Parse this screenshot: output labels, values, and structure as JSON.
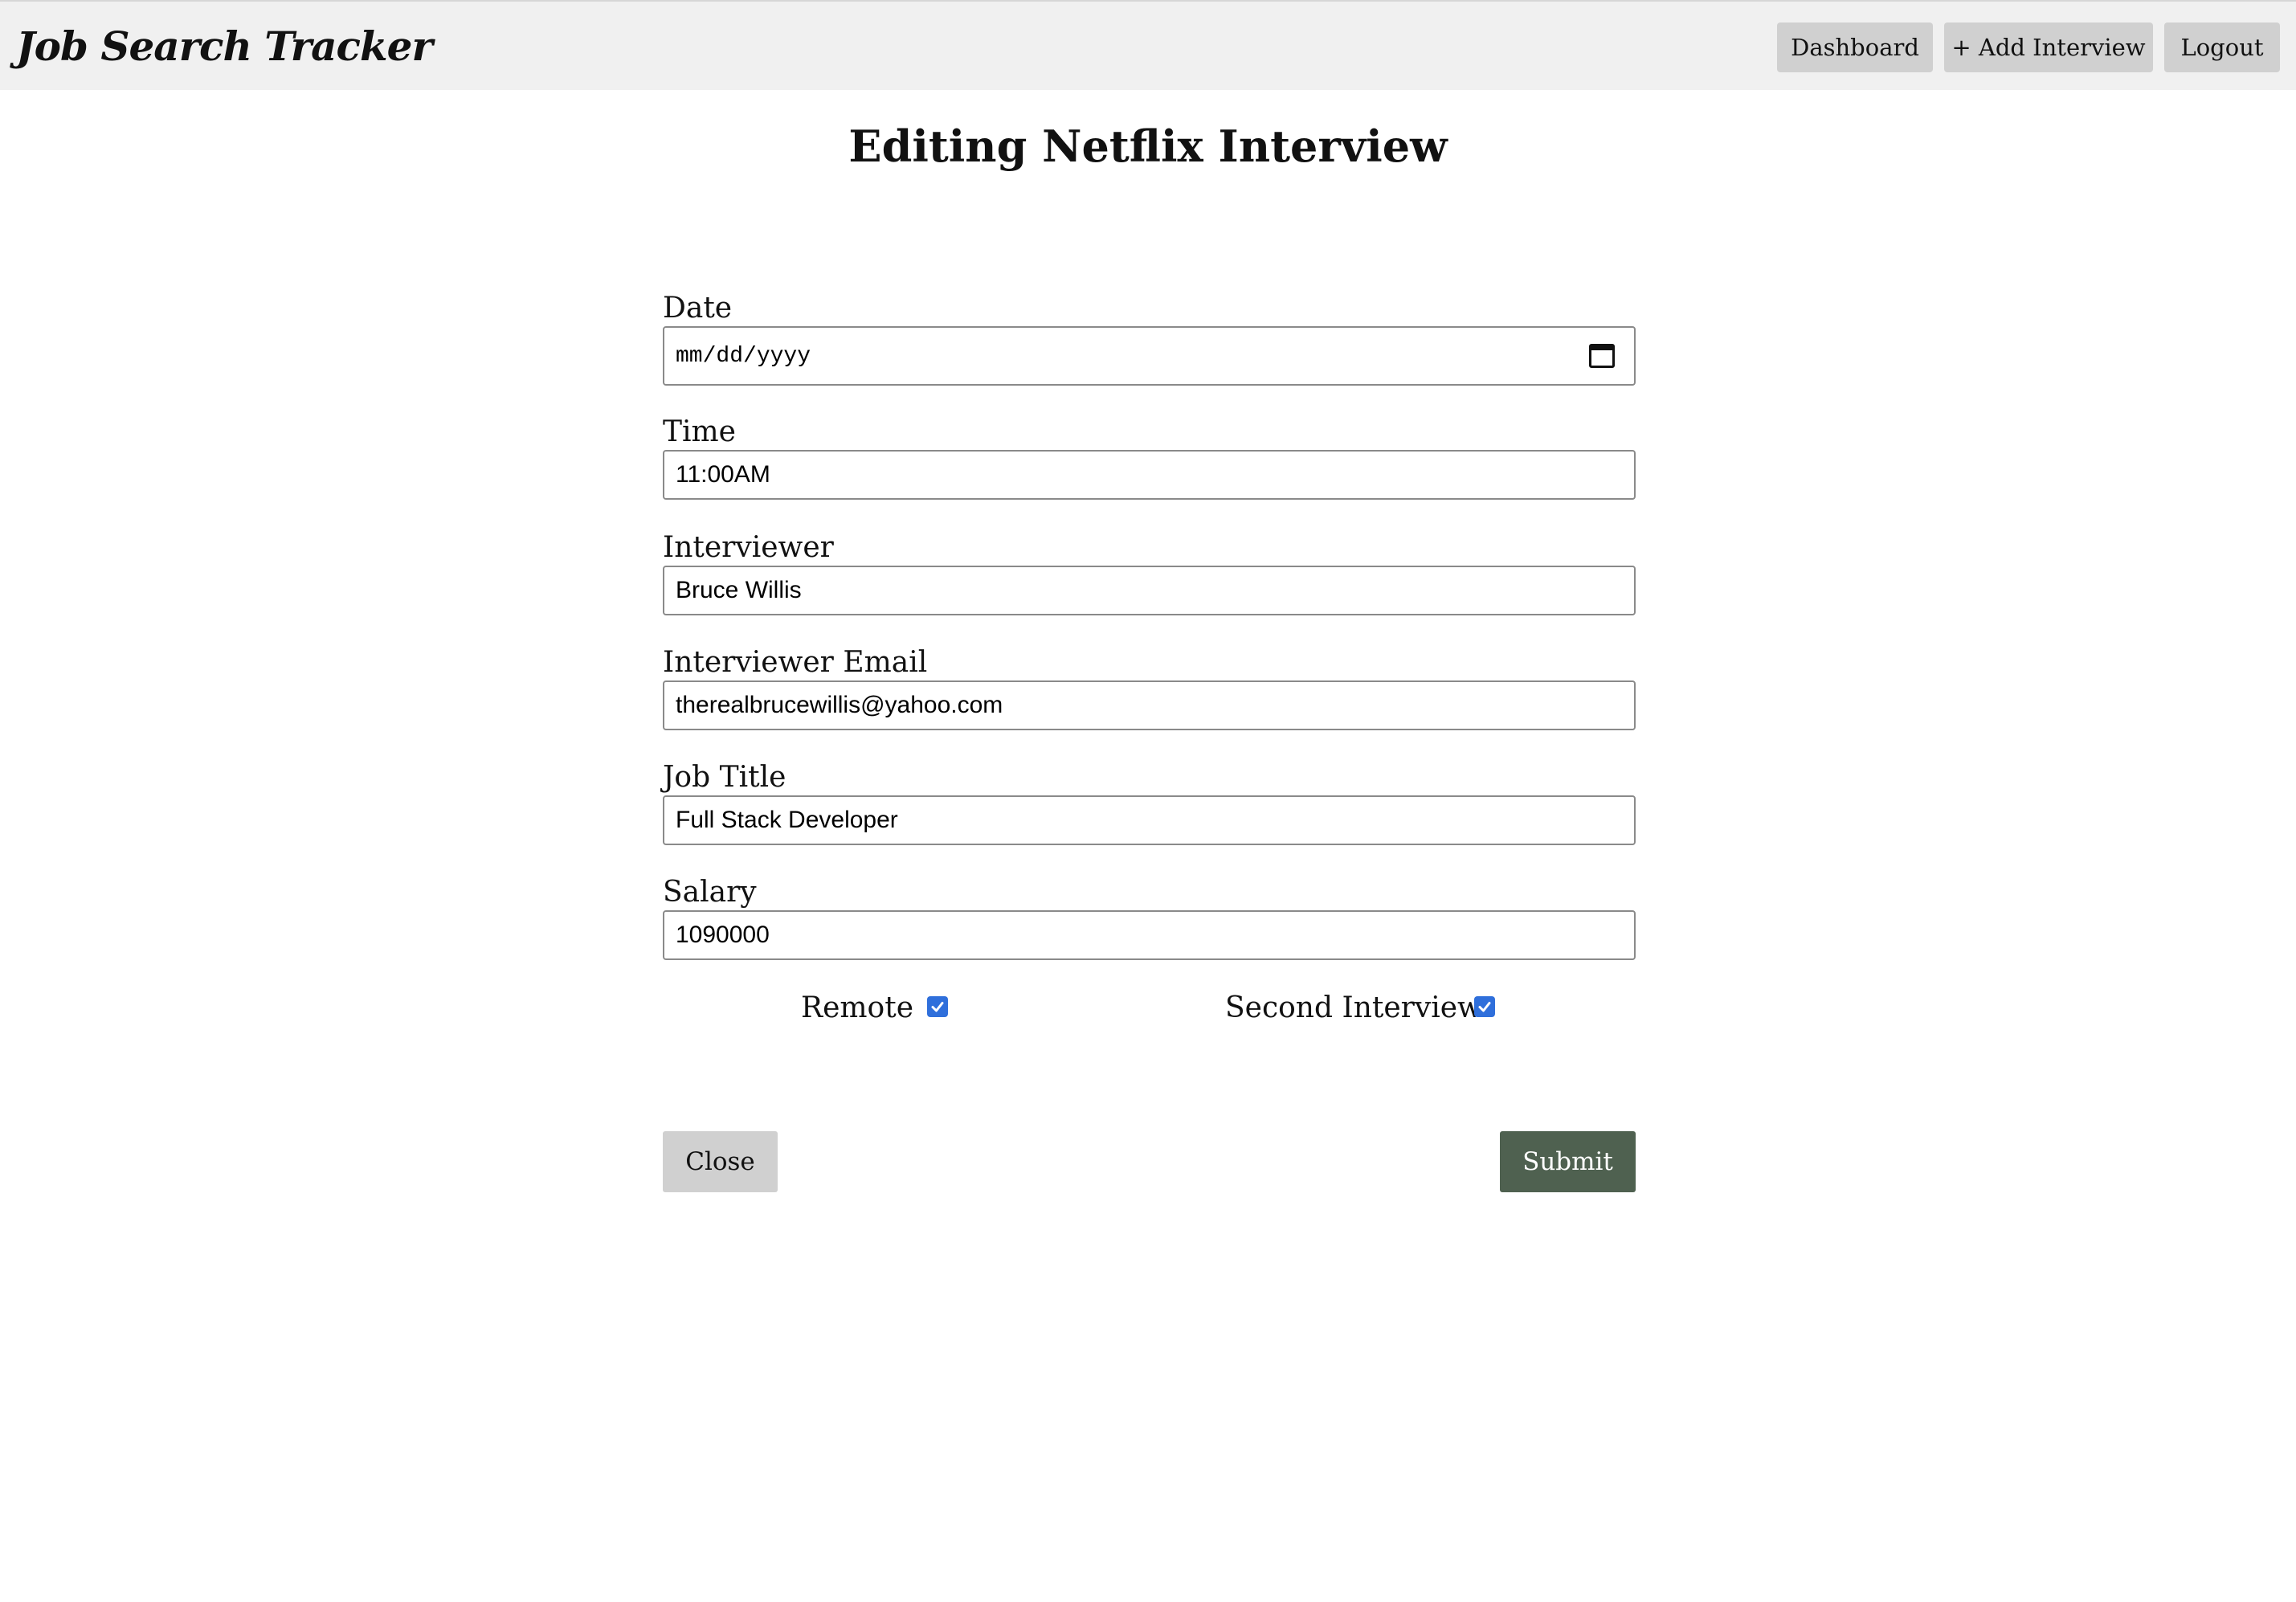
{
  "navbar": {
    "brand": "Job Search Tracker",
    "dashboard_label": "Dashboard",
    "add_interview_label": "+ Add Interview",
    "logout_label": "Logout"
  },
  "page": {
    "title": "Editing Netflix Interview"
  },
  "form": {
    "date": {
      "label": "Date",
      "placeholder": "mm/dd/yyyy",
      "icon": "calendar-icon"
    },
    "time": {
      "label": "Time",
      "value": "11:00AM"
    },
    "interviewer": {
      "label": "Interviewer",
      "value": "Bruce Willis"
    },
    "interviewer_email": {
      "label": "Interviewer Email",
      "value": "therealbrucewillis@yahoo.com"
    },
    "job_title": {
      "label": "Job Title",
      "value": "Full Stack Developer"
    },
    "salary": {
      "label": "Salary",
      "value": "1090000"
    },
    "remote": {
      "label": "Remote",
      "checked": true
    },
    "second_interview": {
      "label": "Second Interview",
      "checked": true
    },
    "close_label": "Close",
    "submit_label": "Submit"
  },
  "colors": {
    "navbar_bg": "#f0f0f0",
    "button_gray": "#d0d0d0",
    "submit_green": "#4f6150",
    "checkbox_blue": "#2f6fdb"
  }
}
